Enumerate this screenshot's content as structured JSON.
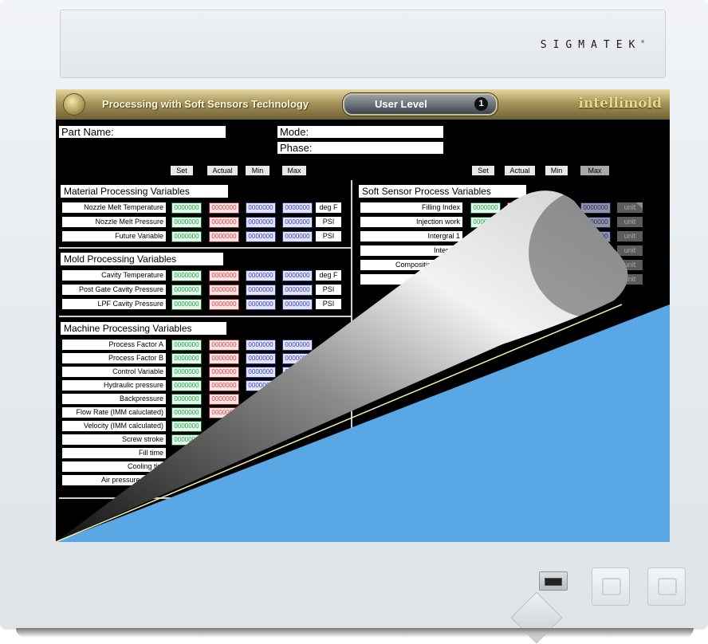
{
  "monitor": {
    "brand": "SIGMATEK",
    "brand_mark": "®"
  },
  "titlebar": {
    "title": "Processing with Soft Sensors Technology",
    "user_level_label": "User Level",
    "user_level_value": "1",
    "logo": "intellimold"
  },
  "header_fields": {
    "part_name_label": "Part Name:",
    "mode_label": "Mode:",
    "phase_label": "Phase:"
  },
  "column_headers": [
    "Set",
    "Actual",
    "Min",
    "Max"
  ],
  "sections": {
    "material": {
      "title": "Material  Processing  Variables",
      "rows": [
        {
          "label": "Nozzle Melt  Temperature",
          "unit": "deg F"
        },
        {
          "label": "Nozzle Melt  Pressure",
          "unit": "PSI"
        },
        {
          "label": "Future  Variable",
          "unit": "PSI"
        }
      ]
    },
    "mold": {
      "title": "Mold Processing  Variables",
      "rows": [
        {
          "label": "Cavity  Temperature",
          "unit": "deg F"
        },
        {
          "label": "Post Gate Cavity  Pressure",
          "unit": "PSI"
        },
        {
          "label": "LPF Cavity Pressure",
          "unit": "PSI"
        }
      ]
    },
    "machine": {
      "title": "Machine Processing  Variables",
      "rows": [
        {
          "label": "Process Factor A"
        },
        {
          "label": "Process Factor  B"
        },
        {
          "label": "Control Variable"
        },
        {
          "label": "Hydraulic  pressure"
        },
        {
          "label": "Backpressure"
        },
        {
          "label": "Flow Rate (IMM caluclated)"
        },
        {
          "label": "Velocity  (IMM calculated)"
        },
        {
          "label": "Screw  stroke"
        },
        {
          "label": "Fill time"
        },
        {
          "label": "Cooling  tim"
        },
        {
          "label": "Air  pressure  P1/  P2"
        }
      ]
    },
    "soft_sensor": {
      "title": "Soft Sensor Process Variables",
      "rows": [
        {
          "label": "Filling  Index",
          "unit": "unit"
        },
        {
          "label": "Injection  work",
          "unit": "unit"
        },
        {
          "label": "Intergral   1",
          "unit": "unit"
        },
        {
          "label": "Intergral",
          "unit": "unit"
        },
        {
          "label": "Compositional",
          "unit": "unit"
        },
        {
          "label": "",
          "unit": "unit"
        }
      ]
    }
  },
  "cell_placeholder": "0000000",
  "colors": {
    "set": "#16a84a",
    "actual": "#d24a4a",
    "min": "#3c45b0",
    "max": "#3c45b0",
    "peel_blue": "#5aa7e6",
    "gold": "#a7935a"
  }
}
